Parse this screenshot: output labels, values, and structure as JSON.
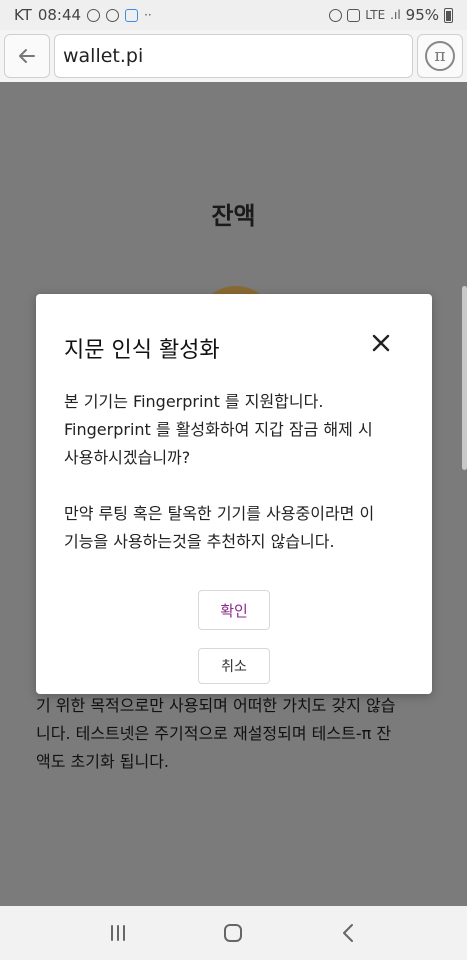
{
  "status_bar": {
    "carrier": "KT",
    "time": "08:44",
    "network": "LTE",
    "battery": "95%"
  },
  "browser": {
    "url": "wallet.pi",
    "back_icon": "arrow-left-icon",
    "pi_icon": "pi-logo-icon"
  },
  "page": {
    "title": "잔액",
    "body_line1": "기 위한 목적으로만 사용되며 어떠한 가치도 갖지 않습",
    "body_line2": "니다. 테스트넷은 주기적으로 재설정되며 테스트-π 잔",
    "body_line3": "액도 초기화 됩니다."
  },
  "modal": {
    "title": "지문 인식 활성화",
    "line1": "본 기기는 Fingerprint 를 지원합니다.",
    "line2": "Fingerprint 를 활성화하여 지갑 잠금 해제 시",
    "line3": "사용하시겠습니까?",
    "line4": "만약 루팅 혹은 탈옥한 기기를 사용중이라면 이",
    "line5": "기능을 사용하는것을 추천하지 않습니다.",
    "confirm_label": "확인",
    "cancel_label": "취소"
  },
  "colors": {
    "overlay": "#7b7b7b",
    "confirm_text": "#8a2a8a"
  }
}
